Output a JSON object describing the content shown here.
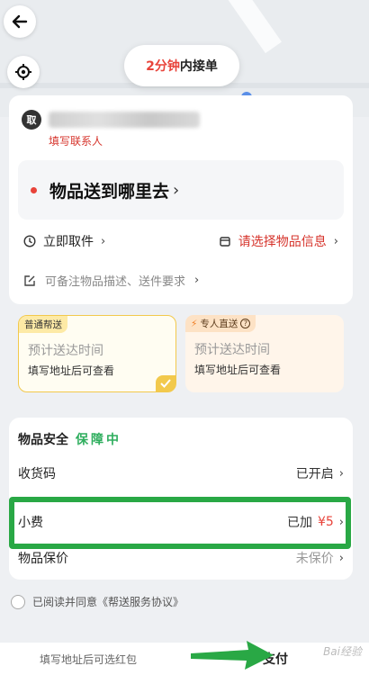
{
  "map": {
    "eta_number": "2分钟",
    "eta_suffix": "内接单"
  },
  "address": {
    "pickup_badge": "取",
    "fill_contact": "填写联系人",
    "destination": "物品送到哪里去",
    "pickup_time": "立即取件",
    "item_info": "请选择物品信息",
    "note": "可备注物品描述、送件要求"
  },
  "services": [
    {
      "tag": "普通帮送",
      "eta": "预计送达时间",
      "sub": "填写地址后可查看"
    },
    {
      "tag": "专人直送",
      "eta": "预计送达时间",
      "sub": "填写地址后可查看"
    }
  ],
  "safety": {
    "title": "物品安全",
    "badge": "保障中",
    "rows": [
      {
        "label": "收货码",
        "value": "已开启"
      },
      {
        "label": "小费",
        "value_prefix": "已加",
        "value_price": "¥5"
      },
      {
        "label": "物品保价",
        "value": "未保价"
      }
    ]
  },
  "agreement": "已阅读并同意《帮送服务协议》",
  "bottom": {
    "hint": "填写地址后可选红包",
    "pay": "支付"
  },
  "watermark": "Bai经验",
  "colors": {
    "accent_red": "#e8433a",
    "green": "#2fae5e",
    "yellow": "#f2c94c",
    "highlight": "#29a845"
  }
}
